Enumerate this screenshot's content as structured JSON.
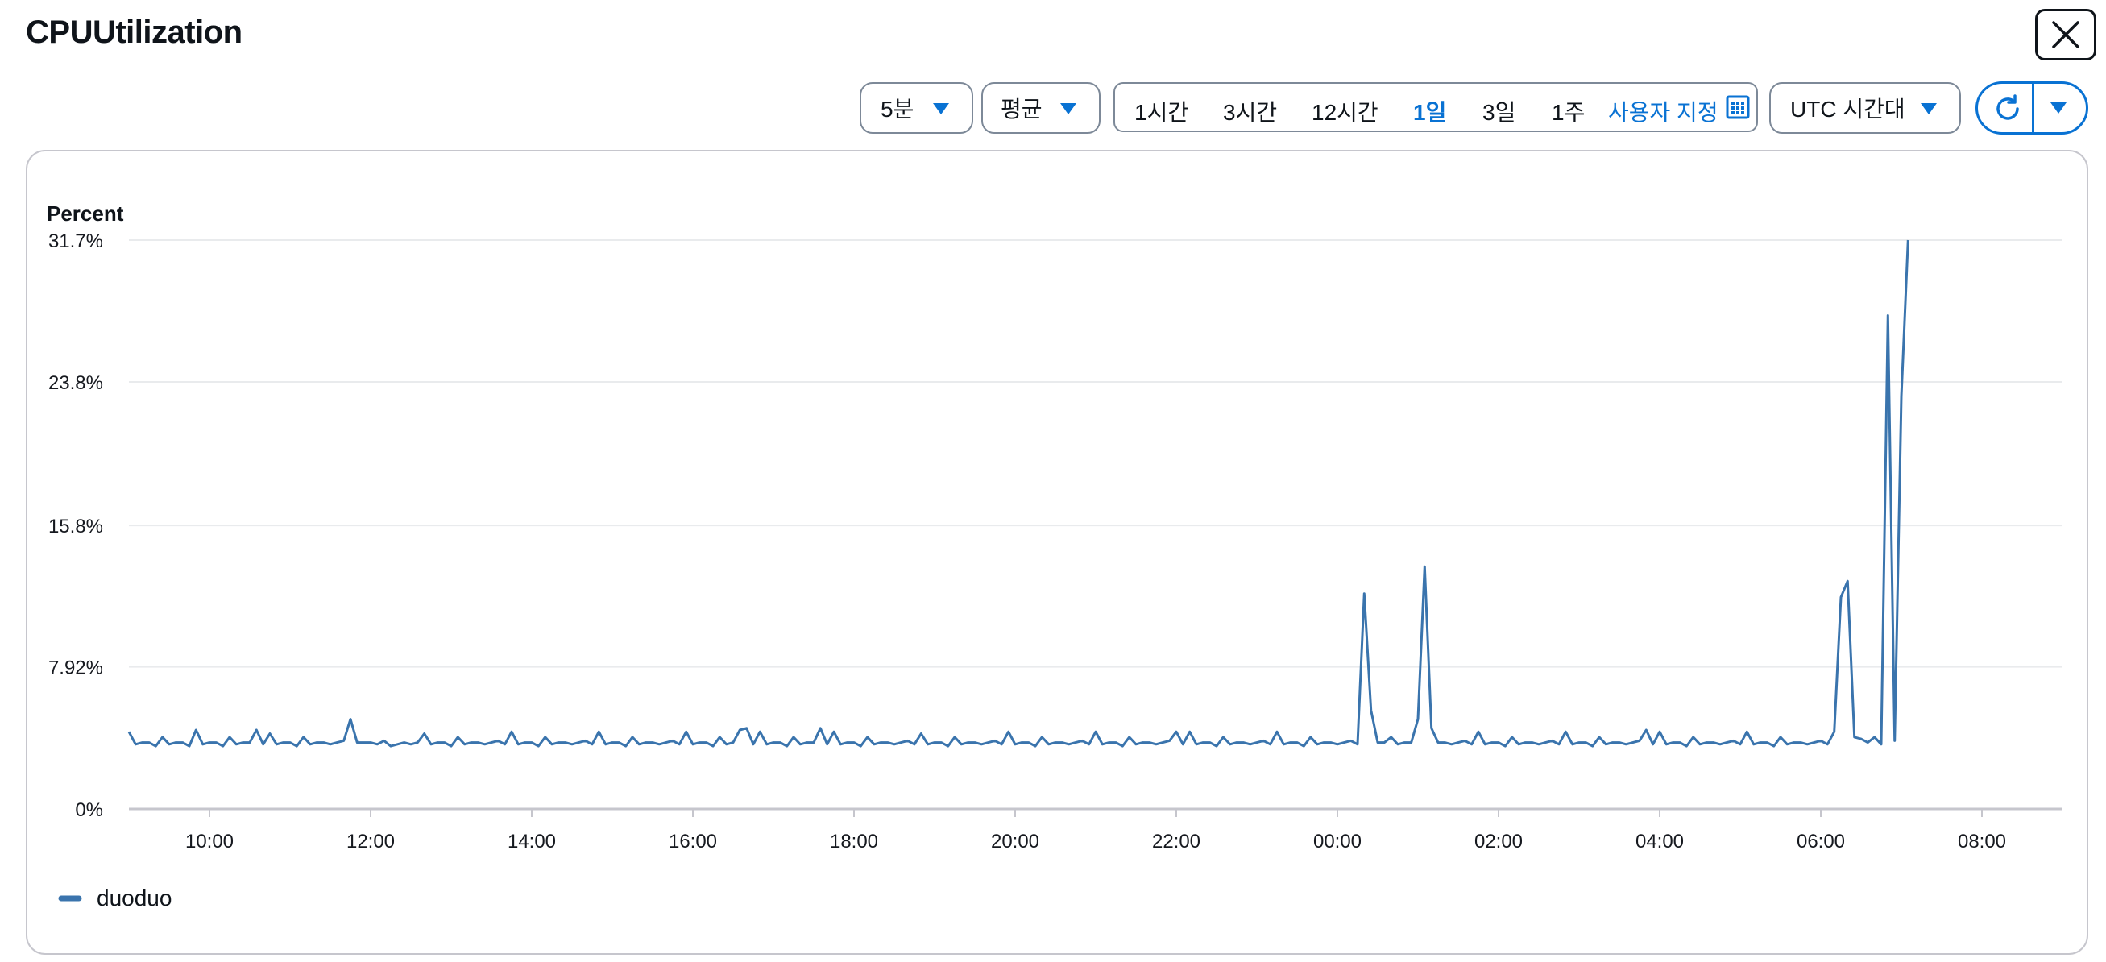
{
  "header": {
    "title": "CPUUtilization",
    "close_icon": "close-icon"
  },
  "controls": {
    "period": "5분",
    "statistic": "평균",
    "ranges": [
      "1시간",
      "3시간",
      "12시간",
      "1일",
      "3일",
      "1주"
    ],
    "active_range": "1일",
    "custom_label": "사용자 지정",
    "calendar_icon": "calendar-icon",
    "timezone": "UTC 시간대",
    "refresh_icon": "refresh-icon",
    "refresh_menu_icon": "caret-down-icon"
  },
  "colors": {
    "accent": "#0972d3",
    "series": "#3a74ad",
    "grid": "#e9ebed",
    "axis": "#c6c6cd"
  },
  "chart_data": {
    "type": "line",
    "title": "",
    "ylabel": "Percent",
    "xlabel": "",
    "grid": true,
    "legend_position": "bottom-left",
    "ylim": [
      0,
      31.7
    ],
    "y_ticks": [
      "0%",
      "7.92%",
      "15.8%",
      "23.8%",
      "31.7%"
    ],
    "y_tick_values": [
      0,
      7.92,
      15.8,
      23.8,
      31.7
    ],
    "x_ticks": [
      "10:00",
      "12:00",
      "14:00",
      "16:00",
      "18:00",
      "20:00",
      "22:00",
      "00:00",
      "02:00",
      "04:00",
      "06:00",
      "08:00"
    ],
    "x_tick_hours": [
      10,
      12,
      14,
      16,
      18,
      20,
      22,
      24,
      26,
      28,
      30,
      32
    ],
    "x_range_hours": [
      9.0,
      33.0
    ],
    "interval_minutes": 5,
    "series": [
      {
        "name": "duoduo",
        "color": "#3a74ad",
        "start_hour": 9.0,
        "values": [
          4.3,
          3.6,
          3.7,
          3.7,
          3.5,
          4.0,
          3.6,
          3.7,
          3.7,
          3.5,
          4.4,
          3.6,
          3.7,
          3.7,
          3.5,
          4.0,
          3.6,
          3.7,
          3.7,
          4.4,
          3.6,
          4.2,
          3.6,
          3.7,
          3.7,
          3.5,
          4.0,
          3.6,
          3.7,
          3.7,
          3.6,
          3.7,
          3.8,
          5.0,
          3.7,
          3.7,
          3.7,
          3.6,
          3.8,
          3.5,
          3.6,
          3.7,
          3.6,
          3.7,
          4.2,
          3.6,
          3.7,
          3.7,
          3.5,
          4.0,
          3.6,
          3.7,
          3.7,
          3.6,
          3.7,
          3.8,
          3.6,
          4.3,
          3.6,
          3.7,
          3.7,
          3.5,
          4.0,
          3.6,
          3.7,
          3.7,
          3.6,
          3.7,
          3.8,
          3.6,
          4.3,
          3.6,
          3.7,
          3.7,
          3.5,
          4.0,
          3.6,
          3.7,
          3.7,
          3.6,
          3.7,
          3.8,
          3.6,
          4.3,
          3.6,
          3.7,
          3.7,
          3.5,
          4.0,
          3.6,
          3.7,
          4.4,
          4.5,
          3.6,
          4.3,
          3.6,
          3.7,
          3.7,
          3.5,
          4.0,
          3.6,
          3.7,
          3.7,
          4.5,
          3.6,
          4.3,
          3.6,
          3.7,
          3.7,
          3.5,
          4.0,
          3.6,
          3.7,
          3.7,
          3.6,
          3.7,
          3.8,
          3.6,
          4.2,
          3.6,
          3.7,
          3.7,
          3.5,
          4.0,
          3.6,
          3.7,
          3.7,
          3.6,
          3.7,
          3.8,
          3.6,
          4.3,
          3.6,
          3.7,
          3.7,
          3.5,
          4.0,
          3.6,
          3.7,
          3.7,
          3.6,
          3.7,
          3.8,
          3.6,
          4.3,
          3.6,
          3.7,
          3.7,
          3.5,
          4.0,
          3.6,
          3.7,
          3.7,
          3.6,
          3.7,
          3.8,
          4.3,
          3.6,
          4.3,
          3.6,
          3.7,
          3.7,
          3.5,
          4.0,
          3.6,
          3.7,
          3.7,
          3.6,
          3.7,
          3.8,
          3.6,
          4.3,
          3.6,
          3.7,
          3.7,
          3.5,
          4.0,
          3.6,
          3.7,
          3.7,
          3.6,
          3.7,
          3.8,
          3.6,
          12.0,
          5.5,
          3.7,
          3.7,
          4.0,
          3.6,
          3.7,
          3.7,
          5.0,
          13.5,
          4.5,
          3.7,
          3.7,
          3.6,
          3.7,
          3.8,
          3.6,
          4.3,
          3.6,
          3.7,
          3.7,
          3.5,
          4.0,
          3.6,
          3.7,
          3.7,
          3.6,
          3.7,
          3.8,
          3.6,
          4.3,
          3.6,
          3.7,
          3.7,
          3.5,
          4.0,
          3.6,
          3.7,
          3.7,
          3.6,
          3.7,
          3.8,
          4.4,
          3.6,
          4.3,
          3.6,
          3.7,
          3.7,
          3.5,
          4.0,
          3.6,
          3.7,
          3.7,
          3.6,
          3.7,
          3.8,
          3.6,
          4.3,
          3.6,
          3.7,
          3.7,
          3.5,
          4.0,
          3.6,
          3.7,
          3.7,
          3.6,
          3.7,
          3.8,
          3.6,
          4.3,
          11.8,
          12.7,
          4.0,
          3.9,
          3.7,
          4.0,
          3.6,
          27.5,
          3.8,
          23.0,
          31.7
        ]
      }
    ]
  }
}
